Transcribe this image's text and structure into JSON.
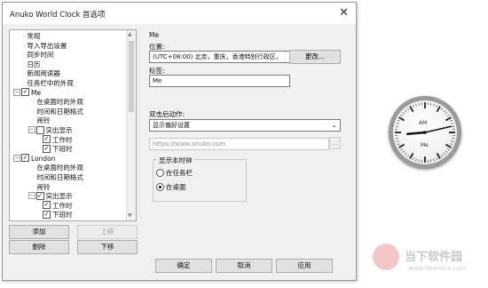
{
  "window": {
    "title": "Anuko World Clock 首选项",
    "close_glyph": "✕"
  },
  "tree": [
    {
      "label": "常规",
      "level": 1,
      "cb": null,
      "toggle": null
    },
    {
      "label": "导入导出设置",
      "level": 1,
      "cb": null,
      "toggle": null
    },
    {
      "label": "同步时间",
      "level": 1,
      "cb": null,
      "toggle": null
    },
    {
      "label": "日历",
      "level": 1,
      "cb": null,
      "toggle": null
    },
    {
      "label": "新闻阅读器",
      "level": 1,
      "cb": null,
      "toggle": null
    },
    {
      "label": "任务栏中的外观",
      "level": 1,
      "cb": null,
      "toggle": null
    },
    {
      "label": "Me",
      "level": 0,
      "cb": true,
      "toggle": "−"
    },
    {
      "label": "在桌面时的外观",
      "level": 2,
      "cb": null,
      "toggle": null
    },
    {
      "label": "时间和日期格式",
      "level": 2,
      "cb": null,
      "toggle": null
    },
    {
      "label": "闹铃",
      "level": 2,
      "cb": null,
      "toggle": null
    },
    {
      "label": "突出显示",
      "level": 1.5,
      "cb": false,
      "toggle": "−"
    },
    {
      "label": "工作时",
      "level": 3,
      "cb": true,
      "toggle": null
    },
    {
      "label": "下班时",
      "level": 3,
      "cb": true,
      "toggle": null
    },
    {
      "label": "London",
      "level": 0,
      "cb": true,
      "toggle": "−"
    },
    {
      "label": "在桌面时的外观",
      "level": 2,
      "cb": null,
      "toggle": null
    },
    {
      "label": "时间和日期格式",
      "level": 2,
      "cb": null,
      "toggle": null
    },
    {
      "label": "闹铃",
      "level": 2,
      "cb": null,
      "toggle": null
    },
    {
      "label": "突出显示",
      "level": 1.5,
      "cb": true,
      "toggle": "−"
    },
    {
      "label": "工作时",
      "level": 3,
      "cb": true,
      "toggle": null
    },
    {
      "label": "下班时",
      "level": 3,
      "cb": true,
      "toggle": null
    }
  ],
  "buttons": {
    "add": "添加",
    "up": "上移",
    "delete": "删除",
    "down": "下移",
    "change": "更改...",
    "browse": "...",
    "ok": "确定",
    "cancel": "取消",
    "apply": "应用"
  },
  "detail": {
    "section": "Me",
    "location_label": "位置:",
    "location_value": "(UTC+08:00) 北京，重庆，香港特别行政区，",
    "tag_label": "标签:",
    "tag_value": "Me",
    "dblclick_label": "双击后动作:",
    "dblclick_value": "显示偏好设置",
    "url_placeholder": "https://www.anuko.com",
    "show_clock_label": "显示本时钟",
    "radio_taskbar": "在任务栏",
    "radio_desktop": "在桌面",
    "selected_radio": "在桌面"
  },
  "clock": {
    "top_label": "AM",
    "bottom_label": "Me"
  },
  "watermark": {
    "text": "当下软件园",
    "url": "www.downxia.com"
  },
  "colors": {
    "dialog_bg": "#f0f0f0",
    "tree_bg": "#ffffff",
    "watermark": "#c9c9c9"
  }
}
